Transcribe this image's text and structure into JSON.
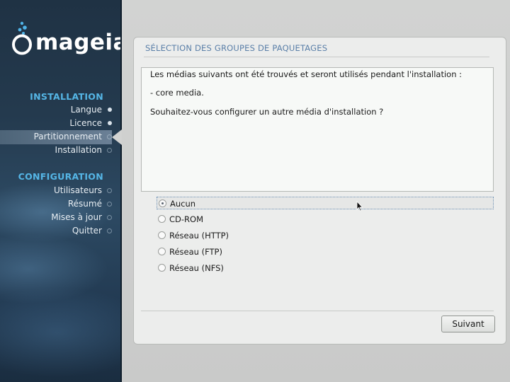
{
  "brand": {
    "name": "mageia"
  },
  "sidebar": {
    "sections": [
      {
        "title": "INSTALLATION",
        "items": [
          {
            "label": "Langue",
            "state": "done"
          },
          {
            "label": "Licence",
            "state": "done"
          },
          {
            "label": "Partitionnement",
            "state": "active"
          },
          {
            "label": "Installation",
            "state": "pending"
          }
        ]
      },
      {
        "title": "CONFIGURATION",
        "items": [
          {
            "label": "Utilisateurs",
            "state": "pending"
          },
          {
            "label": "Résumé",
            "state": "pending"
          },
          {
            "label": "Mises à jour",
            "state": "pending"
          },
          {
            "label": "Quitter",
            "state": "pending"
          }
        ]
      }
    ]
  },
  "panel": {
    "title": "SÉLECTION DES GROUPES DE PAQUETAGES",
    "message": {
      "line1": "Les médias suivants ont été trouvés et seront utilisés pendant l'installation :",
      "line2": "- core media.",
      "line3": "Souhaitez-vous configurer un autre média d'installation ?"
    },
    "options": [
      {
        "label": "Aucun",
        "selected": true
      },
      {
        "label": "CD-ROM",
        "selected": false
      },
      {
        "label": "Réseau (HTTP)",
        "selected": false
      },
      {
        "label": "Réseau (FTP)",
        "selected": false
      },
      {
        "label": "Réseau (NFS)",
        "selected": false
      }
    ],
    "next_label": "Suivant"
  },
  "colors": {
    "accent": "#55b6e6",
    "panel_title": "#5a7fa8",
    "sidebar_bg": "#243a4e"
  }
}
